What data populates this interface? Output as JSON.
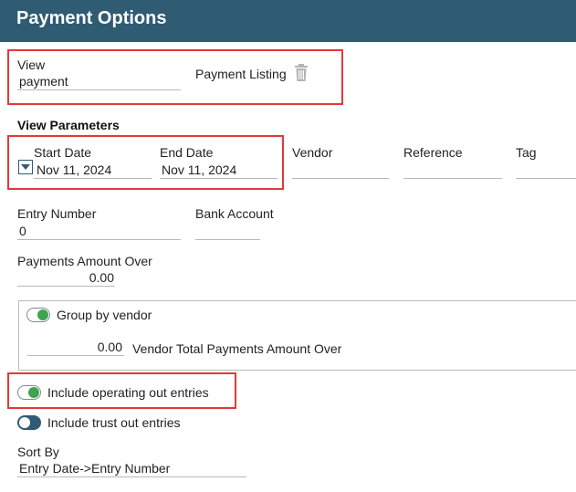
{
  "header": {
    "title": "Payment Options"
  },
  "view": {
    "label": "View",
    "value": "payment",
    "listing_label": "Payment Listing",
    "delete_icon": "trash-icon"
  },
  "view_parameters": {
    "title": "View Parameters",
    "start_date": {
      "label": "Start Date",
      "value": "Nov 11, 2024"
    },
    "end_date": {
      "label": "End Date",
      "value": "Nov 11, 2024"
    },
    "vendor": {
      "label": "Vendor",
      "value": ""
    },
    "reference": {
      "label": "Reference",
      "value": ""
    },
    "tag": {
      "label": "Tag",
      "value": ""
    },
    "entry_number": {
      "label": "Entry Number",
      "value": "0"
    },
    "bank_account": {
      "label": "Bank Account",
      "value": ""
    },
    "payments_amount_over": {
      "label": "Payments Amount Over",
      "value": "0.00"
    }
  },
  "group_by_vendor": {
    "label": "Group by vendor",
    "enabled": true,
    "vendor_total_value": "0.00",
    "vendor_total_label": "Vendor Total Payments Amount Over"
  },
  "include_operating_out": {
    "label": "Include operating out entries",
    "enabled": true
  },
  "include_trust_out": {
    "label": "Include trust out entries",
    "enabled": false
  },
  "sort_by": {
    "label": "Sort By",
    "value": "Entry Date->Entry Number"
  },
  "colors": {
    "header_bg": "#2f5b73",
    "toggle_on": "#3fa34d",
    "highlight": "#e03a3a"
  }
}
